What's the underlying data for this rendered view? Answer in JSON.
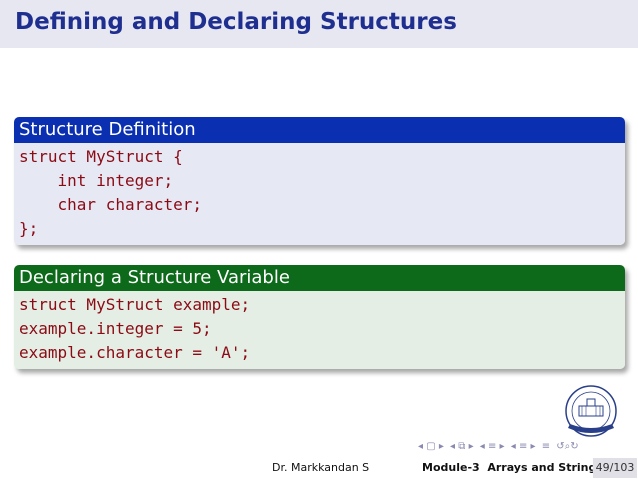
{
  "slide": {
    "title": "Defining and Declaring Structures"
  },
  "blocks": [
    {
      "heading": "Structure Definition",
      "lines": [
        "struct MyStruct {",
        "    int integer;",
        "    char character;",
        "};"
      ]
    },
    {
      "heading": "Declaring a Structure Variable",
      "lines": [
        "struct MyStruct example;",
        "example.integer = 5;",
        "example.character = 'A';"
      ]
    }
  ],
  "footer": {
    "author": "Dr. Markkandan S",
    "module": "Module-3",
    "topic": "Arrays and Strings",
    "page": "49/103"
  },
  "colors": {
    "title": "#1f2f8f",
    "block1_header": "#0a2fb0",
    "block2_header": "#0d6a1a",
    "code_text": "#8b0a14"
  }
}
